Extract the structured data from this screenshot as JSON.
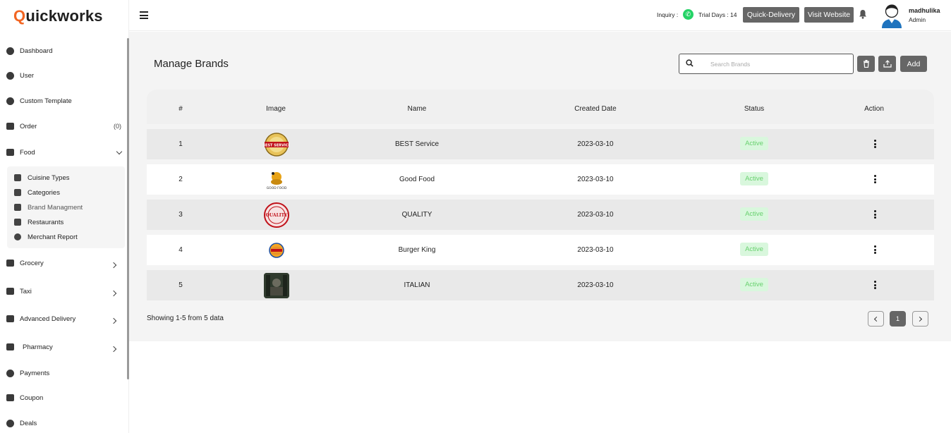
{
  "brand": {
    "logo_q": "Q",
    "logo_rest": "uickworks"
  },
  "sidebar": {
    "items": [
      {
        "label": "Dashboard",
        "icon": "dashboard-icon"
      },
      {
        "label": "User",
        "icon": "user-icon"
      },
      {
        "label": "Custom Template",
        "icon": "template-icon"
      },
      {
        "label": "Order",
        "icon": "basket-icon",
        "count": "(0)"
      },
      {
        "label": "Food",
        "icon": "food-icon"
      },
      {
        "label": "Grocery",
        "icon": "grocery-icon"
      },
      {
        "label": "Taxi",
        "icon": "taxi-icon"
      },
      {
        "label": "Advanced Delivery",
        "icon": "truck-icon"
      },
      {
        "label": "Pharmacy",
        "icon": "pharmacy-icon"
      },
      {
        "label": "Payments",
        "icon": "payments-icon"
      },
      {
        "label": "Coupon",
        "icon": "coupon-icon"
      },
      {
        "label": "Deals",
        "icon": "deals-icon"
      }
    ],
    "food_sub": [
      {
        "label": "Cuisine Types"
      },
      {
        "label": "Categories"
      },
      {
        "label": "Brand Managment"
      },
      {
        "label": "Restaurants"
      },
      {
        "label": "Merchant Report"
      }
    ]
  },
  "topbar": {
    "inquiry": "Inquiry :",
    "trial": "Trial Days : 14",
    "quick_delivery": "Quick-Delivery",
    "visit_website": "Visit Website",
    "user_name": "madhulika",
    "user_role": "Admin"
  },
  "main": {
    "title": "Manage Brands",
    "search_placeholder": "Search Brands",
    "add_label": "Add",
    "columns": [
      "#",
      "Image",
      "Name",
      "Created Date",
      "Status",
      "Action"
    ],
    "rows": [
      {
        "num": "1",
        "name": "BEST Service",
        "date": "2023-03-10",
        "status": "Active"
      },
      {
        "num": "2",
        "name": "Good Food",
        "date": "2023-03-10",
        "status": "Active"
      },
      {
        "num": "3",
        "name": "QUALITY",
        "date": "2023-03-10",
        "status": "Active"
      },
      {
        "num": "4",
        "name": "Burger King",
        "date": "2023-03-10",
        "status": "Active"
      },
      {
        "num": "5",
        "name": "ITALIAN",
        "date": "2023-03-10",
        "status": "Active"
      }
    ],
    "showing": "Showing 1-5 from 5 data",
    "current_page": "1"
  },
  "colors": {
    "accent": "#f26522",
    "button": "#666666",
    "status_bg": "#d9f7dd",
    "status_text": "#69d16f"
  }
}
